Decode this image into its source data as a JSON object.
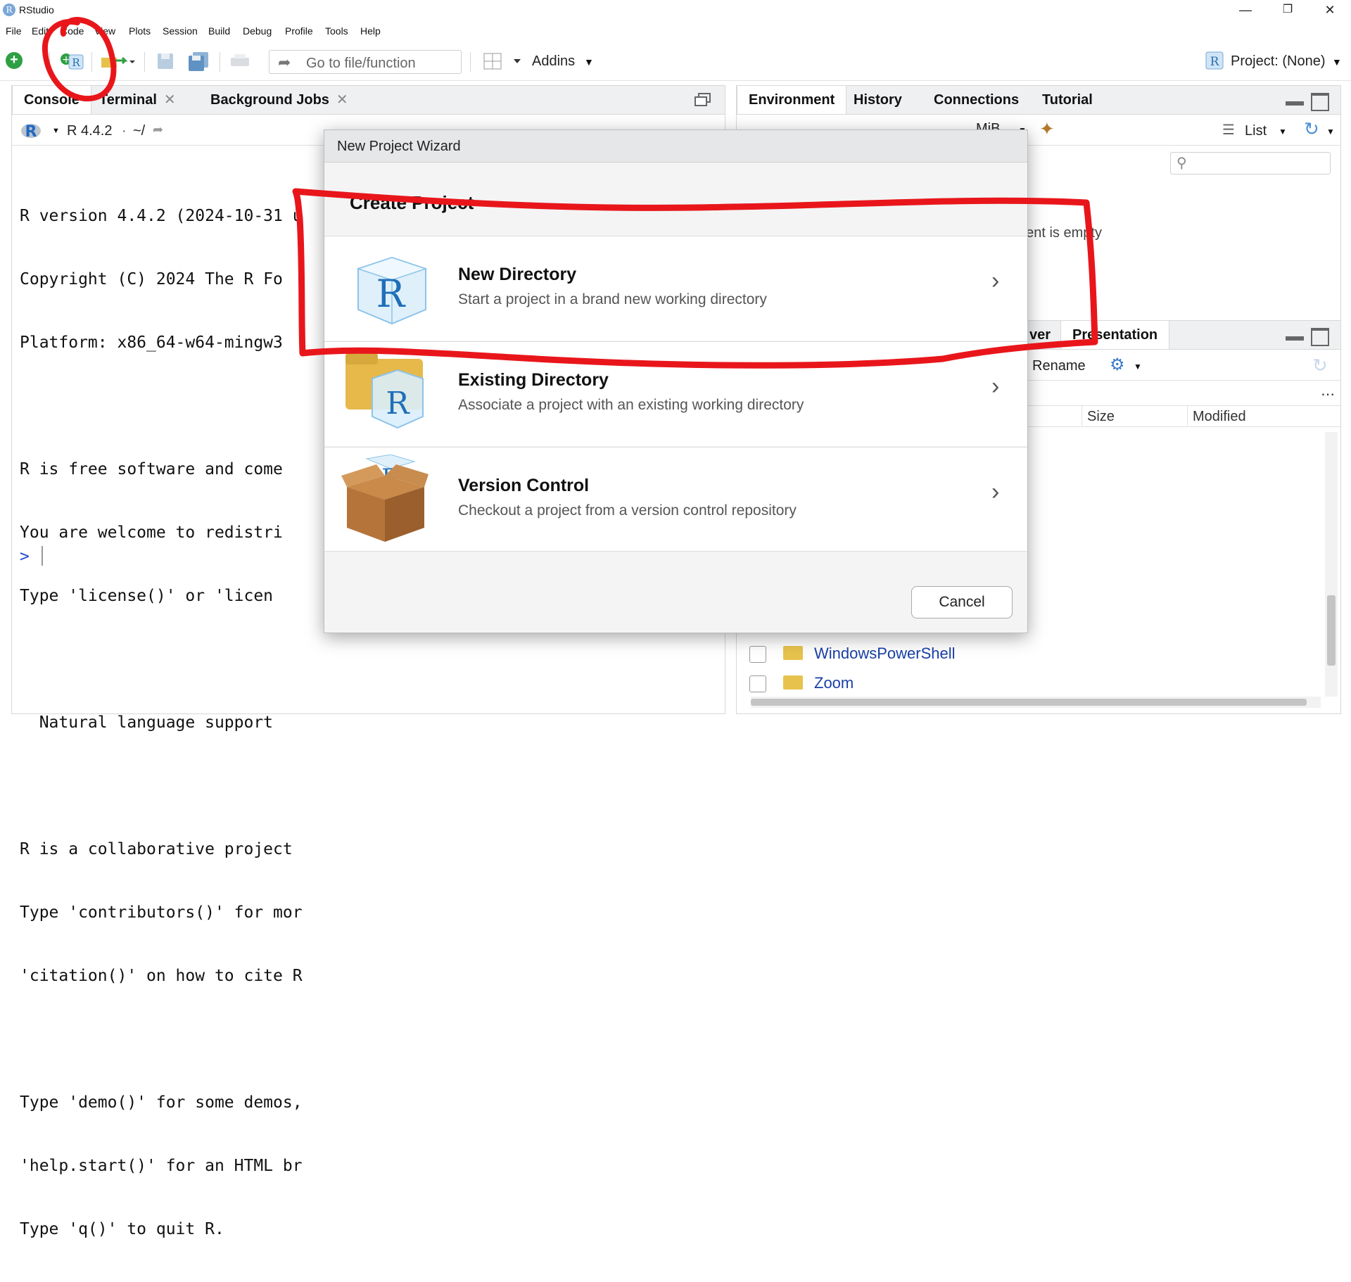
{
  "window": {
    "title": "RStudio",
    "app_icon": "R"
  },
  "menu": [
    "File",
    "Edit",
    "Code",
    "View",
    "Plots",
    "Session",
    "Build",
    "Debug",
    "Profile",
    "Tools",
    "Help"
  ],
  "toolbar": {
    "goto_placeholder": "Go to file/function",
    "addins_label": "Addins",
    "project_label": "Project: (None)"
  },
  "left_pane": {
    "tabs": [
      {
        "label": "Console",
        "closable": false
      },
      {
        "label": "Terminal",
        "closable": true
      },
      {
        "label": "Background Jobs",
        "closable": true
      }
    ],
    "r_version": "R 4.4.2",
    "path": "~/",
    "console_lines": [
      "R version 4.4.2 (2024-10-31 u",
      "Copyright (C) 2024 The R Fo",
      "Platform: x86_64-w64-mingw3",
      "",
      "R is free software and come",
      "You are welcome to redistri",
      "Type 'license()' or 'licen",
      "",
      "  Natural language support",
      "",
      "R is a collaborative project",
      "Type 'contributors()' for mor",
      "'citation()' on how to cite R",
      "",
      "Type 'demo()' for some demos,",
      "'help.start()' for an HTML br",
      "Type 'q()' to quit R."
    ],
    "prompt": ">"
  },
  "env_pane": {
    "tabs": [
      "Environment",
      "History",
      "Connections",
      "Tutorial"
    ],
    "memory": "MiB",
    "list_label": "List",
    "empty_text": "nent is empty"
  },
  "files_pane": {
    "tabs_visible": [
      "ver",
      "Presentation"
    ],
    "rename_label": "Rename",
    "columns": [
      "Size",
      "Modified"
    ],
    "rows": [
      {
        "name": "WindowsPowerShell"
      },
      {
        "name": "Zoom"
      }
    ]
  },
  "dialog": {
    "title": "New Project Wizard",
    "heading": "Create Project",
    "options": [
      {
        "title": "New Directory",
        "desc": "Start a project in a brand new working directory",
        "icon": "r-cube-icon"
      },
      {
        "title": "Existing Directory",
        "desc": "Associate a project with an existing working directory",
        "icon": "folder-r-icon"
      },
      {
        "title": "Version Control",
        "desc": "Checkout a project from a version control repository",
        "icon": "box-icon"
      }
    ],
    "cancel_label": "Cancel"
  },
  "annotation_color": "#e8161b"
}
